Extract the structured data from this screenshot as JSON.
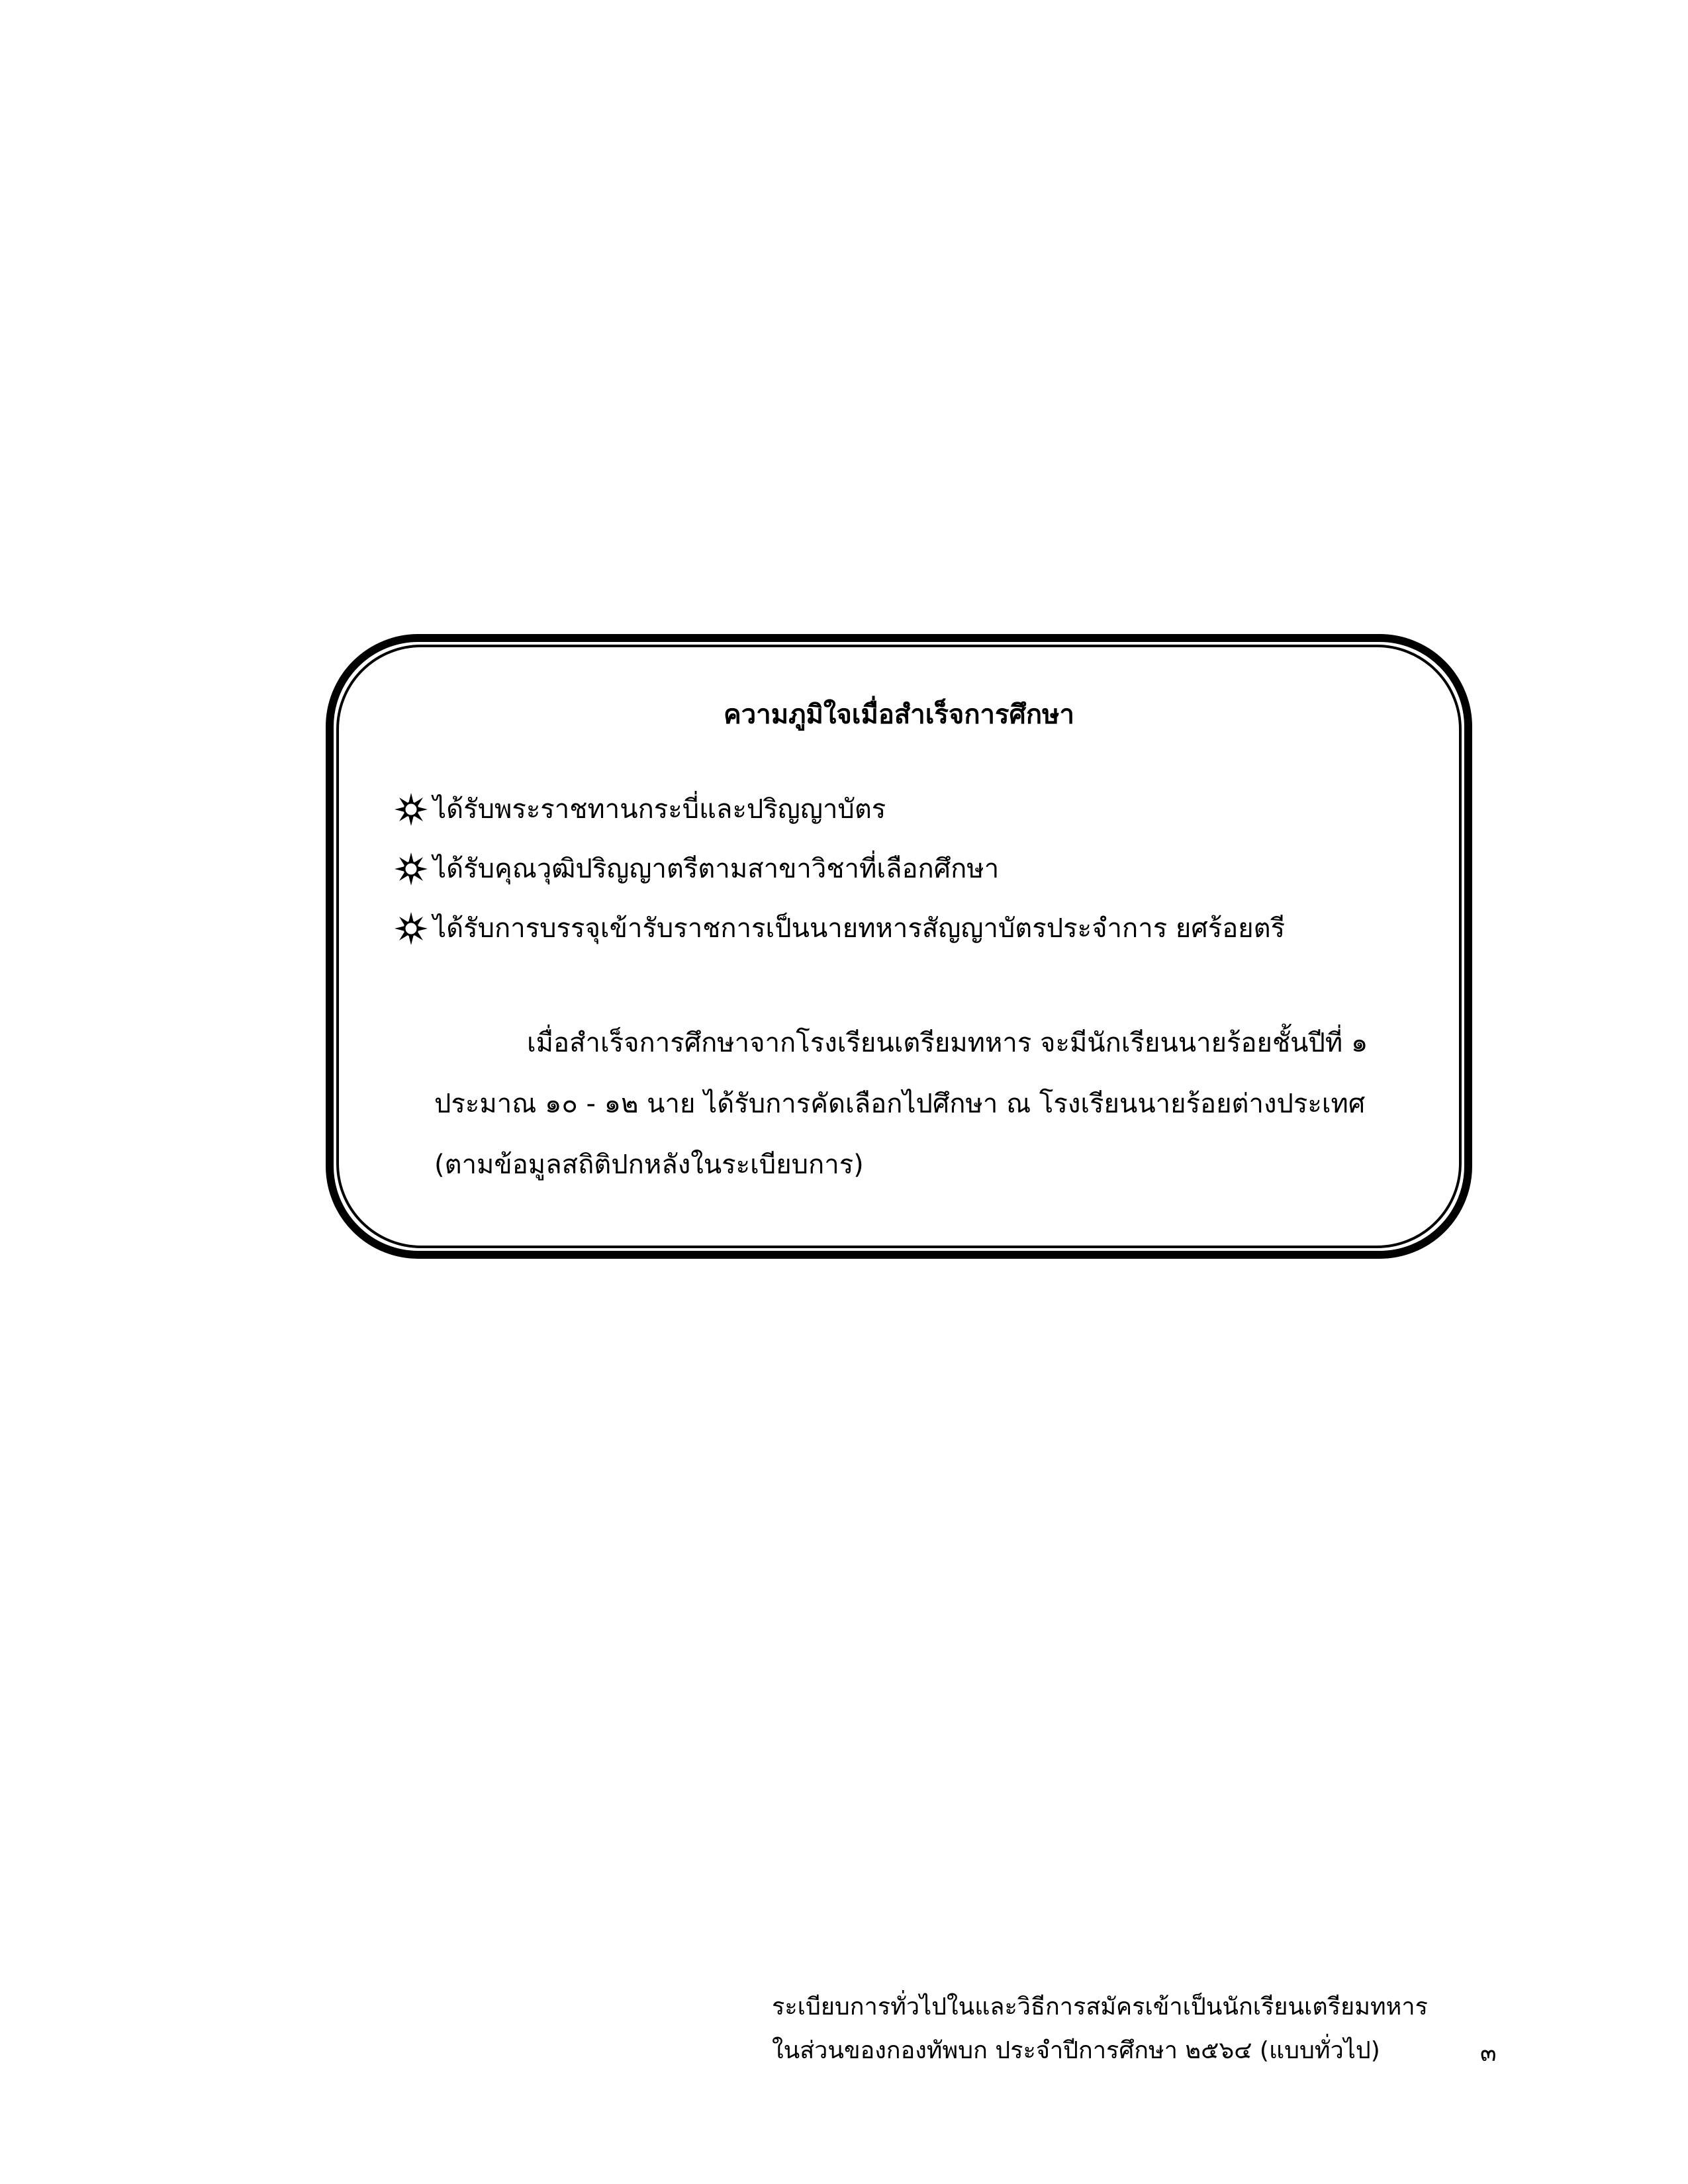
{
  "box": {
    "title": "ความภูมิใจเมื่อสำเร็จการศึกษา",
    "bullets": [
      "ได้รับพระราชทานกระบี่และปริญญาบัตร",
      "ได้รับคุณวุฒิปริญญาตรีตามสาขาวิชาที่เลือกศึกษา",
      "ได้รับการบรรจุเข้ารับราชการเป็นนายทหารสัญญาบัตรประจำการ ยศร้อยตรี"
    ],
    "paragraph_lines": [
      "เมื่อสำเร็จการศึกษาจากโรงเรียนเตรียมทหาร จะมีนักเรียนนายร้อยชั้นปีที่ ๑",
      "ประมาณ ๑๐ - ๑๒ นาย ได้รับการคัดเลือกไปศึกษา ณ โรงเรียนนายร้อยต่างประเทศ",
      "(ตามข้อมูลสถิติปกหลังในระเบียบการ)"
    ]
  },
  "footer": {
    "line1": "ระเบียบการทั่วไปในและวิธีการสมัครเข้าเป็นนักเรียนเตรียมทหาร",
    "line2": "ในส่วนของกองทัพบก ประจำปีการศึกษา ๒๕๖๔ (แบบทั่วไป)",
    "page_number": "๓"
  },
  "icons": {
    "bullet": "sun-icon"
  }
}
